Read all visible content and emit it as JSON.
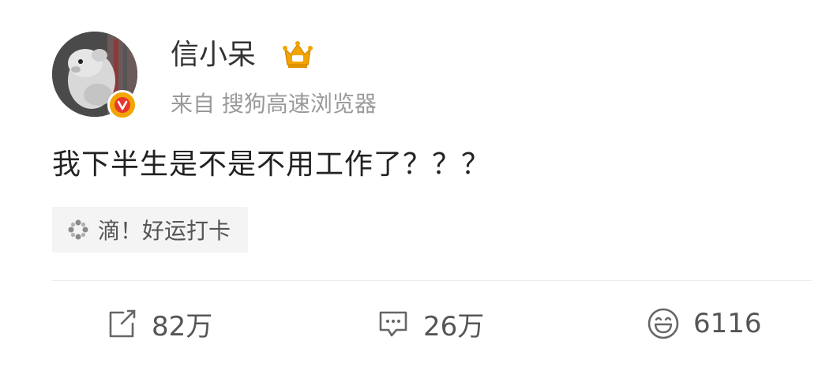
{
  "post": {
    "author": {
      "name": "信小呆",
      "verified_badge_letter": "V",
      "badge_color": "#f2a500",
      "crown_color": "#f2a500"
    },
    "source": "来自 搜狗高速浏览器",
    "text": "我下半生是不是不用工作了？？？",
    "topic_tag": {
      "icon": "sparkle-icon",
      "label": "滴！好运打卡"
    }
  },
  "actions": {
    "repost": {
      "icon": "repost-icon",
      "count": "82万"
    },
    "comment": {
      "icon": "comment-icon",
      "count": "26万"
    },
    "like": {
      "icon": "smile-like-icon",
      "count": "6116"
    }
  }
}
